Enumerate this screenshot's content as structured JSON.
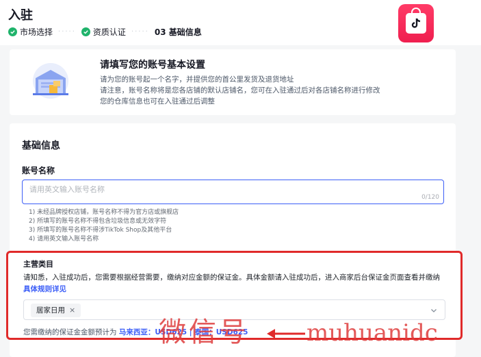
{
  "header": {
    "title": "入驻",
    "steps": [
      {
        "label": "市场选择",
        "status": "done"
      },
      {
        "label": "资质认证",
        "status": "done"
      },
      {
        "label": "03 基础信息",
        "status": "current"
      }
    ],
    "logo_icon": "tiktok-shop-bag-icon"
  },
  "info": {
    "title": "请填写您的账号基本设置",
    "lines": [
      "请为您的账号起一个名字，并提供您的首公里发货及退货地址",
      "请注意，账号名称将是您各店铺的默认店铺名，您可在入驻通过后对各店铺名称进行修改",
      "您的仓库信息也可在入驻通过后调整"
    ]
  },
  "form": {
    "section_title": "基础信息",
    "account_name": {
      "label": "账号名称",
      "placeholder": "请用英文输入账号名称",
      "value": "",
      "counter": "0/120"
    },
    "rules": [
      "1) 未经品牌授权店铺，账号名称不得为官方店或旗舰店",
      "2) 所填写的账号名称不得包含垃圾信息或无效字符",
      "3) 所填写的账号名称不得涉TikTok Shop及其他平台",
      "4) 请用英文输入账号名称"
    ],
    "category": {
      "title": "主营类目",
      "desc": "请知悉，入驻成功后，您需要根据经营需要，缴纳对应金额的保证金。具体金额请入驻成功后，进入商家后台保证金页面查看并缴纳",
      "rule_link": "具体规则详见",
      "selected_tag": "居家日用",
      "tag_close": "×",
      "deposit_prefix": "您需缴纳的保证金金额预计为",
      "deposit_my": "马来西亚：USD625",
      "deposit_sep": " | ",
      "deposit_th": "泰国：USD625"
    }
  },
  "annotation": {
    "highlight_color": "#e02a2a",
    "watermark_cn": "微信号",
    "watermark_en": "muhuanidc"
  },
  "colors": {
    "accent": "#3c5ef7",
    "success": "#1fb36b",
    "brand": "#ef1f4f"
  }
}
